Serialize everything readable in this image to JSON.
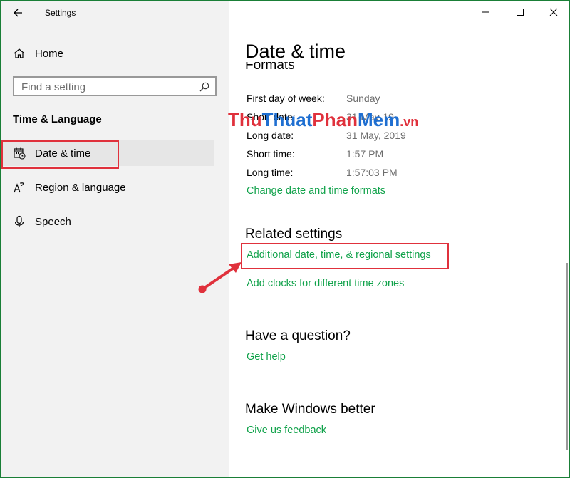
{
  "window": {
    "title": "Settings"
  },
  "sidebar": {
    "home_label": "Home",
    "search_placeholder": "Find a setting",
    "section_title": "Time & Language",
    "items": [
      {
        "label": "Date & time",
        "icon": "calendar-clock-icon",
        "selected": true
      },
      {
        "label": "Region & language",
        "icon": "language-icon",
        "selected": false
      },
      {
        "label": "Speech",
        "icon": "microphone-icon",
        "selected": false
      }
    ]
  },
  "main": {
    "page_title": "Date & time",
    "formats_heading": "Formats",
    "formats": [
      {
        "label": "First day of week:",
        "value": "Sunday"
      },
      {
        "label": "Short date:",
        "value": "31-May-19"
      },
      {
        "label": "Long date:",
        "value": "31 May, 2019"
      },
      {
        "label": "Short time:",
        "value": "1:57 PM"
      },
      {
        "label": "Long time:",
        "value": "1:57:03 PM"
      }
    ],
    "change_formats_link": "Change date and time formats",
    "related_heading": "Related settings",
    "related_links": [
      "Additional date, time, & regional settings",
      "Add clocks for different time zones"
    ],
    "question_heading": "Have a question?",
    "get_help_link": "Get help",
    "better_heading": "Make Windows better",
    "feedback_link": "Give us feedback"
  },
  "watermark": {
    "part1": "Thu",
    "part2": "Thuat",
    "part3": "Phan",
    "part4": "Mem",
    "part5": ".vn"
  },
  "colors": {
    "accent_link": "#10a24a",
    "highlight_box": "#e0313c",
    "sidebar_bg": "#f2f2f2"
  }
}
